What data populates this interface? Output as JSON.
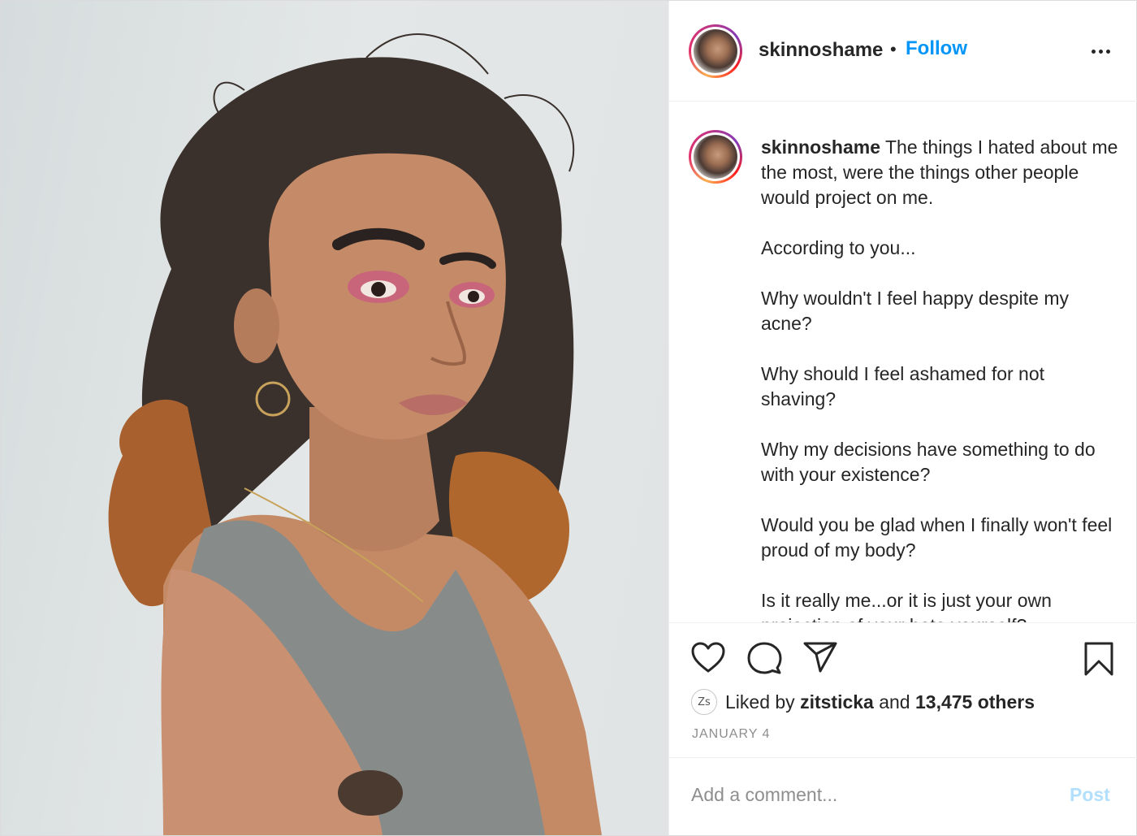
{
  "post": {
    "username": "skinnoshame",
    "separator": "•",
    "follow_label": "Follow",
    "more_icon": "more-options-icon"
  },
  "caption": {
    "username": "skinnoshame",
    "paragraphs": [
      "The things I hated about me the most, were the things other people would project on me.",
      "According to you...",
      "Why wouldn't I feel happy despite my acne?",
      "Why should I feel ashamed for not shaving?",
      "Why my decisions have something to do with your existence?",
      "Would you be glad when I finally won't feel proud of my body?",
      "Is it really me...or it is just your own projection of your hate yourself?"
    ]
  },
  "actions": {
    "icons": [
      "heart-icon",
      "comment-icon",
      "share-icon",
      "bookmark-icon"
    ]
  },
  "likes": {
    "liker_avatar_text": "Zs",
    "prefix": "Liked by",
    "liker": "zitsticka",
    "middle": "and",
    "others": "13,475 others"
  },
  "date": "JANUARY 4",
  "comment": {
    "placeholder": "Add a comment...",
    "post_label": "Post"
  },
  "colors": {
    "link_blue": "#0095f6",
    "post_disabled": "#b2dffc",
    "muted": "#8e8e8e",
    "text": "#262626"
  }
}
